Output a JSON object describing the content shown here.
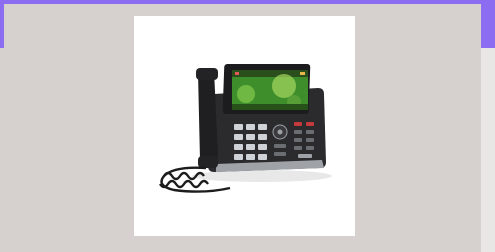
{
  "product": {
    "icon": "desk-ip-phone-icon",
    "description_shown": false
  },
  "colors": {
    "accent": "#8c6cf0",
    "background": "#d6d0cf",
    "card": "#ffffff",
    "phone_body": "#2b2b2e",
    "screen_green": "#3e8f2c"
  }
}
